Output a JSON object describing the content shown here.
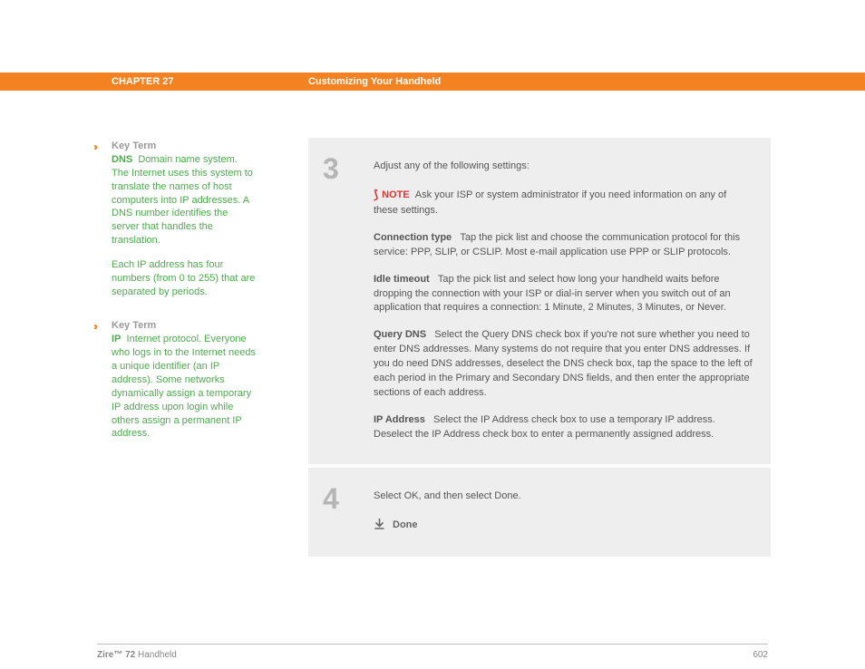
{
  "header": {
    "chapter": "CHAPTER 27",
    "title": "Customizing Your Handheld"
  },
  "sidebar": {
    "key_terms": [
      {
        "heading": "Key Term",
        "term": "DNS",
        "body": "Domain name system. The Internet uses this system to translate the names of host computers into IP addresses. A DNS number identifies the server that handles the translation.",
        "extra": "Each IP address has four numbers (from 0 to 255) that are separated by periods."
      },
      {
        "heading": "Key Term",
        "term": "IP",
        "body": "Internet protocol. Everyone who logs in to the Internet needs a unique identifier (an IP address). Some networks dynamically assign a temporary IP address upon login while others assign a permanent IP address."
      }
    ]
  },
  "steps": [
    {
      "num": "3",
      "intro": "Adjust any of the following settings:",
      "note_label": "NOTE",
      "note_body": "Ask your ISP or system administrator if you need information on any of these settings.",
      "settings": [
        {
          "name": "Connection type",
          "text": "Tap the pick list and choose the communication protocol for this service: PPP, SLIP, or CSLIP. Most e-mail application use PPP or SLIP protocols."
        },
        {
          "name": "Idle timeout",
          "text": "Tap the pick list and select how long your handheld waits before dropping the connection with your ISP or dial-in server when you switch out of an application that requires a connection: 1 Minute, 2 Minutes, 3 Minutes, or Never."
        },
        {
          "name": "Query DNS",
          "text": "Select the Query DNS check box if you're not sure whether you need to enter DNS addresses. Many systems do not require that you enter DNS addresses. If you do need DNS addresses, deselect the DNS check box, tap the space to the left of each period in the Primary and Secondary DNS fields, and then enter the appropriate sections of each address."
        },
        {
          "name": "IP Address",
          "text": "Select the IP Address check box to use a temporary IP address. Deselect the IP Address check box to enter a permanently assigned address."
        }
      ]
    },
    {
      "num": "4",
      "intro": "Select OK, and then select Done.",
      "done": "Done"
    }
  ],
  "footer": {
    "brand_bold": "Zire™ 72",
    "brand_rest": " Handheld",
    "page": "602"
  }
}
